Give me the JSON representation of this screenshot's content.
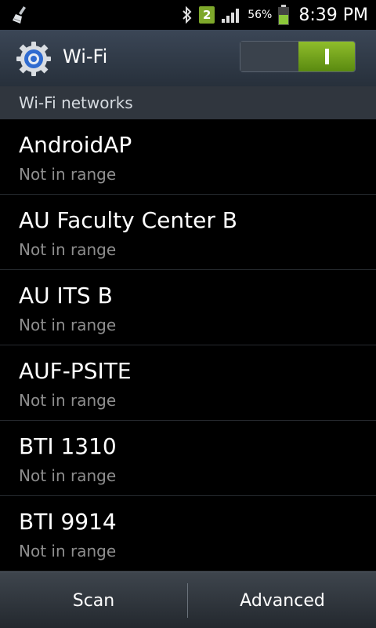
{
  "status_bar": {
    "left_icon": "broom-icon",
    "bluetooth_icon": "bluetooth-icon",
    "notification_badge": "2",
    "signal_icon": "signal-icon",
    "battery_percent": "56%",
    "battery_icon": "battery-icon",
    "time": "8:39 PM"
  },
  "header": {
    "title": "Wi-Fi",
    "icon": "settings-gear-icon",
    "toggle_on": true,
    "colors": {
      "toggle_on": "#7cb31f"
    }
  },
  "section": {
    "label": "Wi-Fi networks"
  },
  "networks": [
    {
      "name": "AndroidAP",
      "status": "Not in range"
    },
    {
      "name": "AU Faculty Center B",
      "status": "Not in range"
    },
    {
      "name": "AU ITS B",
      "status": "Not in range"
    },
    {
      "name": "AUF-PSITE",
      "status": "Not in range"
    },
    {
      "name": "BTI 1310",
      "status": "Not in range"
    },
    {
      "name": "BTI 9914",
      "status": "Not in range"
    }
  ],
  "bottom_bar": {
    "scan_label": "Scan",
    "advanced_label": "Advanced"
  }
}
